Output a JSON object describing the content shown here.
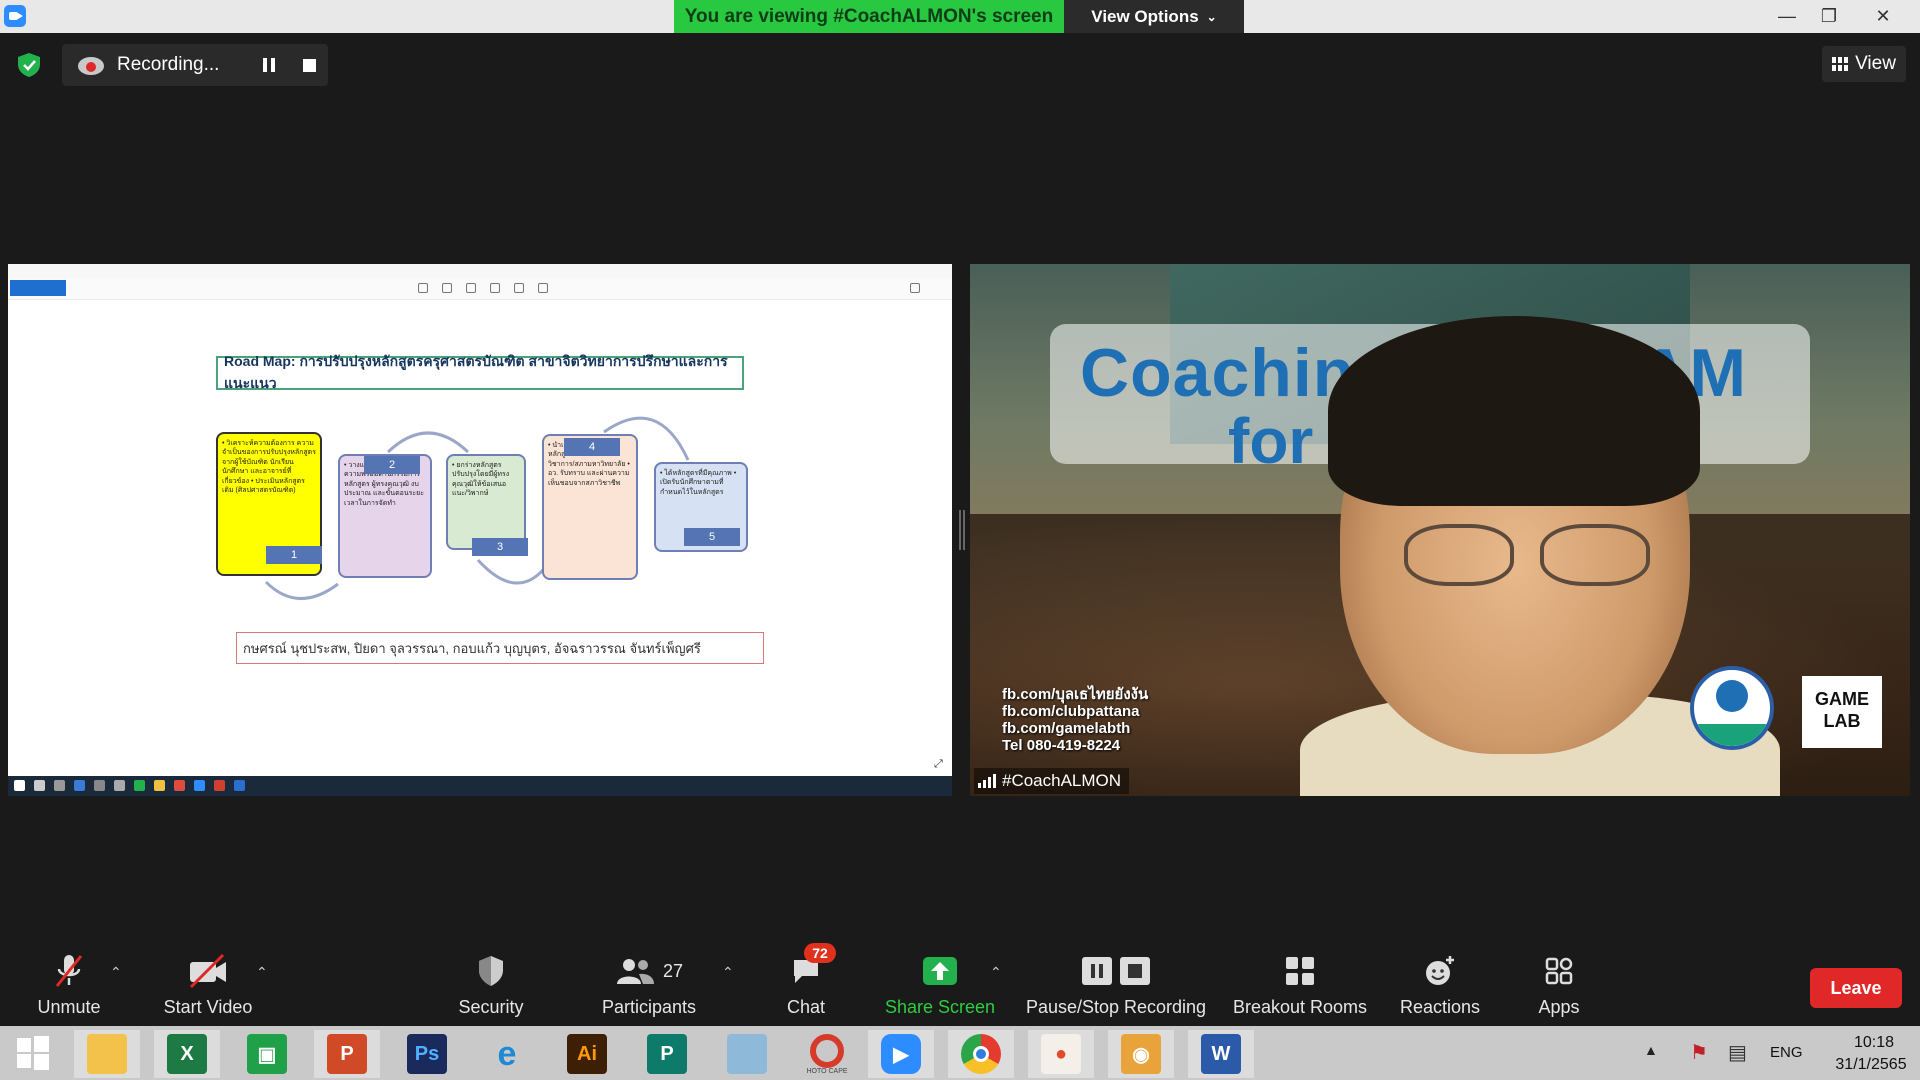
{
  "titlebar": {
    "viewing_banner": "You are viewing #CoachALMON's screen",
    "view_options": "View Options"
  },
  "recording": {
    "status": "Recording..."
  },
  "view_button": "View",
  "shared_screen": {
    "roadmap_title": "Road Map: การปรับปรุงหลักสูตรครุศาสตรบัณฑิต สาขาจิตวิทยาการปรึกษาและการแนะแนว",
    "steps": [
      {
        "num": "1",
        "text": "• วิเคราะห์ความต้องการ ความจำเป็นของการปรับปรุงหลักสูตรจากผู้ใช้บัณฑิต นักเรียน นักศึกษา และอาจารย์ที่เกี่ยวข้อง • ประเมินหลักสูตรเดิม (ศิลปศาสตรบัณฑิต)"
      },
      {
        "num": "2",
        "text": "• วางแนวทางจัดเตรียมความพร้อมด้านกรรมการหลักสูตร ผู้ทรงคุณวุฒิ งบประมาณ และขั้นตอนระยะเวลาในการจัดทำ"
      },
      {
        "num": "3",
        "text": "• ยกร่างหลักสูตรปรับปรุงโดยมีผู้ทรงคุณวุฒิให้ข้อเสนอแนะ/วิพากษ์"
      },
      {
        "num": "4",
        "text": "• นำเสนอและปรับปรุงหลักสูตรต่อคณะ/สภาวิชาการ/สภามหาวิทยาลัย • อว. รับทราบ และผ่านความเห็นชอบจากสภาวิชาชีพ"
      },
      {
        "num": "5",
        "text": "• ได้หลักสูตรที่มีคุณภาพ • เปิดรับนักศึกษาตามที่กำหนดไว้ในหลักสูตร"
      }
    ],
    "authors": "กษศรณ์ นุชประสพ, ปิยดา จุลวรรณา, กอบแก้ว บุญบุตร, อัจฉราวรรณ จันทร์เพ็ญศรี"
  },
  "video": {
    "participant_name": "#CoachALMON",
    "overlay_text_1": "Coachin",
    "overlay_text_2": "GRAM",
    "overlay_text_3": "for",
    "social_lines": [
      "fb.com/บุลเธไทยยังงัน",
      "fb.com/clubpattana",
      "fb.com/gamelabth",
      "Tel 080-419-8224"
    ],
    "gamelab_logo": "GAME LAB"
  },
  "toolbar": {
    "unmute": "Unmute",
    "start_video": "Start Video",
    "security": "Security",
    "participants": "Participants",
    "participants_count": "27",
    "chat": "Chat",
    "chat_badge": "72",
    "share_screen": "Share Screen",
    "pause_stop": "Pause/Stop Recording",
    "breakout": "Breakout Rooms",
    "reactions": "Reactions",
    "apps": "Apps",
    "leave": "Leave"
  },
  "taskbar": {
    "apps": [
      "File Explorer",
      "Excel",
      "Store",
      "PowerPoint",
      "Photoshop",
      "Internet Explorer",
      "Illustrator",
      "Publisher",
      "Notepad",
      "PhotoScape",
      "Zoom",
      "Chrome",
      "Photos",
      "Camera",
      "Word"
    ],
    "photoscape_caption": "HOTO CAPE",
    "lang": "ENG",
    "time": "10:18",
    "date": "31/1/2565"
  },
  "colors": {
    "banner_green": "#28c840",
    "leave_red": "#e02828",
    "share_green": "#2ecc40",
    "zoom_blue": "#2d8cff"
  }
}
